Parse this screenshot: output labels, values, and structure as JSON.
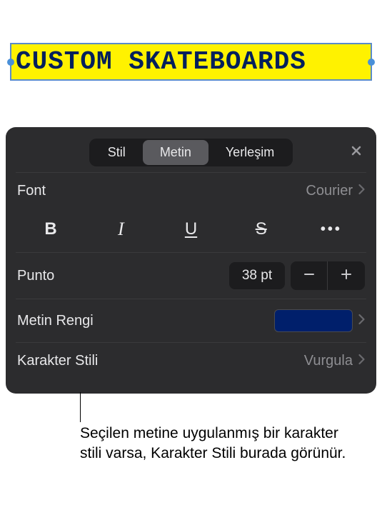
{
  "textbox": {
    "content": "CUSTOM SKATEBOARDS"
  },
  "panel": {
    "tabs": {
      "style": "Stil",
      "text": "Metin",
      "layout": "Yerleşim"
    },
    "font": {
      "label": "Font",
      "value": "Courier"
    },
    "textStyles": {
      "bold": "B",
      "italic": "I",
      "underline": "U",
      "strike": "S"
    },
    "size": {
      "label": "Punto",
      "value": "38 pt"
    },
    "textColor": {
      "label": "Metin Rengi",
      "colorHex": "#001f6b"
    },
    "characterStyle": {
      "label": "Karakter Stili",
      "value": "Vurgula"
    }
  },
  "callout": {
    "text": "Seçilen metine uygulanmış bir karakter stili varsa, Karakter Stili burada görünür."
  }
}
